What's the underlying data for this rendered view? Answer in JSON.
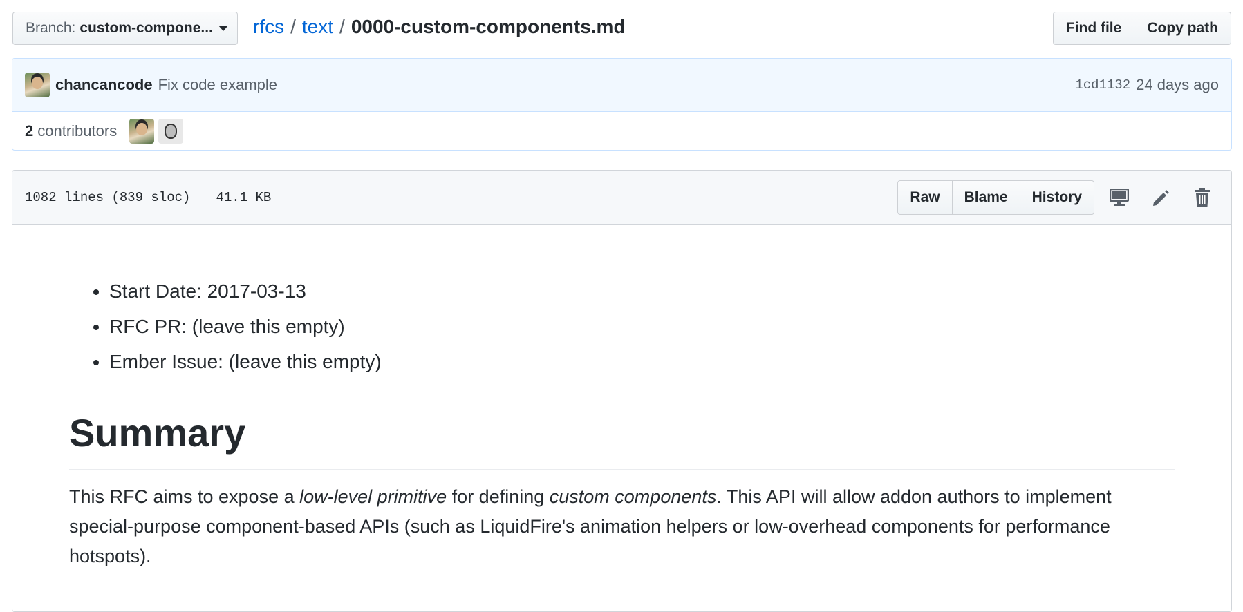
{
  "branch": {
    "label": "Branch:",
    "name": "custom-compone..."
  },
  "breadcrumb": {
    "repo": "rfcs",
    "sep1": "/",
    "folder": "text",
    "sep2": "/",
    "file": "0000-custom-components.md"
  },
  "top_buttons": {
    "find_file": "Find file",
    "copy_path": "Copy path"
  },
  "commit": {
    "author": "chancancode",
    "message": "Fix code example",
    "sha": "1cd1132",
    "age": "24 days ago"
  },
  "contributors": {
    "count": "2",
    "label": "contributors"
  },
  "file_header": {
    "lines": "1082 lines (839 sloc)",
    "size": "41.1 KB",
    "raw": "Raw",
    "blame": "Blame",
    "history": "History"
  },
  "icons": {
    "display": "desktop-icon",
    "edit": "pencil-icon",
    "delete": "trash-icon"
  },
  "markdown": {
    "list": [
      "Start Date: 2017-03-13",
      "RFC PR: (leave this empty)",
      "Ember Issue: (leave this empty)"
    ],
    "heading": "Summary",
    "paragraph": {
      "part1": "This RFC aims to expose a ",
      "em1": "low-level primitive",
      "part2": " for defining ",
      "em2": "custom components",
      "part3": ". This API will allow addon authors to implement special-purpose component-based APIs (such as LiquidFire's animation helpers or low-overhead components for performance hotspots)."
    }
  },
  "colors": {
    "link": "#0366d6",
    "commit_bg": "#f1f8ff",
    "commit_border": "#c8e1ff",
    "header_bg": "#f6f8fa"
  }
}
